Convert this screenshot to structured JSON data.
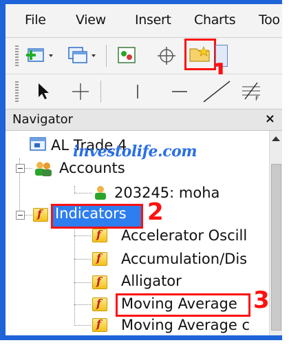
{
  "menu": [
    "File",
    "View",
    "Insert",
    "Charts",
    "Too"
  ],
  "navigator": {
    "title": "Navigator",
    "close": "×",
    "root": "AL Trade 4",
    "accounts_label": "Accounts",
    "account_entry": "203245: moha",
    "indicators_label": "Indicators",
    "indicators": [
      "Accelerator Oscill",
      "Accumulation/Dis",
      "Alligator",
      "Moving Average",
      "Moving Average c"
    ]
  },
  "watermark": "investolife.com",
  "markers": [
    "1",
    "2",
    "3"
  ],
  "colors": {
    "frame": "#1e63d8",
    "highlight_box": "#ff1010",
    "selection": "#2e7ef0"
  }
}
